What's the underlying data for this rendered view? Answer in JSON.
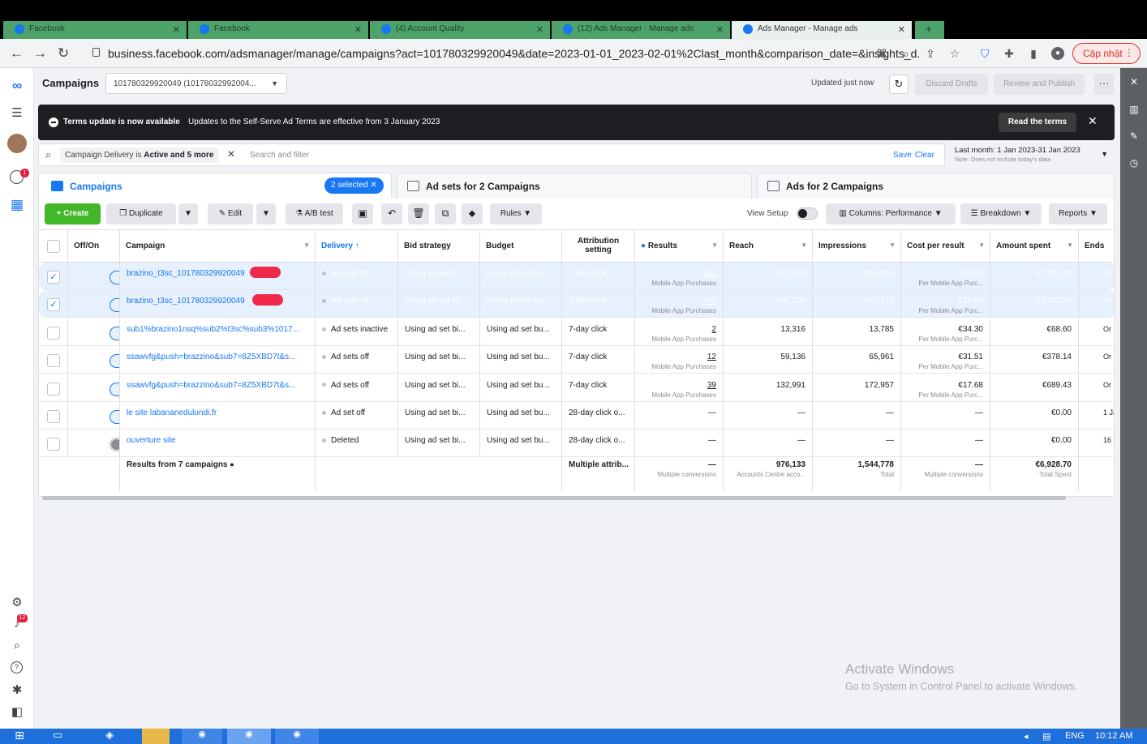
{
  "browser": {
    "tabs": [
      {
        "label": "Facebook"
      },
      {
        "label": "Facebook"
      },
      {
        "label": "(4) Account Quality"
      },
      {
        "label": "(12) Ads Manager - Manage ads"
      },
      {
        "label": "Ads Manager - Manage ads"
      }
    ],
    "url": "business.facebook.com/adsmanager/manage/campaigns?act=101780329920049&date=2023-01-01_2023-02-01%2Clast_month&comparison_date=&insights_d...",
    "update_label": "Cập nhật"
  },
  "topbar": {
    "title": "Campaigns",
    "account": "101780329920049 (10178032992004...",
    "updated": "Updated just now",
    "discard": "Discard Drafts",
    "review": "Review and Publish",
    "more": "···"
  },
  "banner": {
    "title": "Terms update is now available",
    "text": "Updates to the Self-Serve Ad Terms are effective from 3 January 2023",
    "button": "Read the terms"
  },
  "filter": {
    "chip_prefix": "Campaign Delivery is",
    "chip_bold": "Active and 5 more",
    "placeholder": "Search and filter",
    "save": "Save",
    "clear": "Clear",
    "date_range": "Last month: 1 Jan 2023-31 Jan 2023",
    "date_note": "Note: Does not include today's data"
  },
  "levels": {
    "campaigns": "Campaigns",
    "selected": "2 selected",
    "adsets": "Ad sets for 2 Campaigns",
    "ads": "Ads for 2 Campaigns"
  },
  "toolbar": {
    "create": "+ Create",
    "duplicate": "Duplicate",
    "edit": "Edit",
    "abtest": "A/B test",
    "rules": "Rules",
    "view_setup": "View Setup",
    "columns": "Columns: Performance",
    "breakdown": "Breakdown",
    "reports": "Reports"
  },
  "table": {
    "headers": {
      "offon": "Off/On",
      "campaign": "Campaign",
      "delivery": "Delivery ↑",
      "bid": "Bid strategy",
      "budget": "Budget",
      "attr1": "Attribution",
      "attr2": "setting",
      "results": "Results",
      "reach": "Reach",
      "impressions": "Impressions",
      "cpr": "Cost per result",
      "spent": "Amount spent",
      "ends": "Ends"
    },
    "rows": [
      {
        "checked": "✓",
        "campaign": "brazino_t3sc_101780329920049",
        "delivery": "Ad sets off",
        "bid": "Using ad set bi...",
        "budget": "Using ad set bu...",
        "attr": "7-day click",
        "results": "163",
        "results_sub": "Mobile App Purchases",
        "reach": "472,195",
        "impressions": "619,361",
        "cpr": "€17.06",
        "cpr_sub": "Per Mobile App Purc...",
        "spent": "€2,781.25",
        "ends": "Or"
      },
      {
        "checked": "✓",
        "campaign": "brazino_t3sc_101780329920049",
        "delivery": "Ad sets off",
        "bid": "Using ad set bi...",
        "budget": "Using ad set bu...",
        "attr": "7-day click",
        "results": "159",
        "results_sub": "Mobile App Purchases",
        "reach": "495,236",
        "impressions": "672,714",
        "cpr": "€18.94",
        "cpr_sub": "Per Mobile App Purc...",
        "spent": "€3,011.28",
        "ends": "Or"
      },
      {
        "checked": "",
        "campaign": "sub1%brazino1nsq%sub2%t3sc%sub3%1017...",
        "delivery": "Ad sets inactive",
        "bid": "Using ad set bi...",
        "budget": "Using ad set bu...",
        "attr": "7-day click",
        "results": "2",
        "results_sub": "Mobile App Purchases",
        "reach": "13,316",
        "impressions": "13,785",
        "cpr": "€34.30",
        "cpr_sub": "Per Mobile App Purc...",
        "spent": "€68.60",
        "ends": "Or"
      },
      {
        "checked": "",
        "campaign": "ssawvfg&push=brazzino&sub7=8Z5XBD7t&s...",
        "delivery": "Ad sets off",
        "bid": "Using ad set bi...",
        "budget": "Using ad set bu...",
        "attr": "7-day click",
        "results": "12",
        "results_sub": "Mobile App Purchases",
        "reach": "59,136",
        "impressions": "65,961",
        "cpr": "€31.51",
        "cpr_sub": "Per Mobile App Purc...",
        "spent": "€378.14",
        "ends": "Or"
      },
      {
        "checked": "",
        "campaign": "ssawvfg&push=brazzino&sub7=8Z5XBD7t&s...",
        "delivery": "Ad sets off",
        "bid": "Using ad set bi...",
        "budget": "Using ad set bu...",
        "attr": "7-day click",
        "results": "39",
        "results_sub": "Mobile App Purchases",
        "reach": "132,991",
        "impressions": "172,957",
        "cpr": "€17.68",
        "cpr_sub": "Per Mobile App Purc...",
        "spent": "€689.43",
        "ends": "Or"
      },
      {
        "checked": "",
        "campaign": "le site labananedulundi.fr",
        "delivery": "Ad set off",
        "bid": "Using ad set bi...",
        "budget": "Using ad set bu...",
        "attr": "28-day click o...",
        "results": "—",
        "results_sub": "",
        "reach": "—",
        "impressions": "—",
        "cpr": "—",
        "cpr_sub": "",
        "spent": "€0.00",
        "ends": "1 Ja"
      },
      {
        "checked": "",
        "campaign": "ouverture site",
        "delivery": "Deleted",
        "bid": "Using ad set bi...",
        "budget": "Using ad set bu...",
        "attr": "28-day click o...",
        "results": "—",
        "results_sub": "",
        "reach": "—",
        "impressions": "—",
        "cpr": "—",
        "cpr_sub": "",
        "spent": "€0.00",
        "ends": "16 O"
      }
    ],
    "totals": {
      "label": "Results from 7 campaigns",
      "attr": "Multiple attrib...",
      "results": "—",
      "results_sub": "Multiple conversions",
      "reach": "976,133",
      "reach_sub": "Accounts Centre acco...",
      "impressions": "1,544,778",
      "impressions_sub": "Total",
      "cpr": "—",
      "cpr_sub": "Multiple conversions",
      "spent": "€6,928.70",
      "spent_sub": "Total Spent"
    }
  },
  "watermark": {
    "title": "Activate Windows",
    "text": "Go to System in Control Panel to activate Windows."
  },
  "taskbar": {
    "lang": "ENG",
    "time": "10:12 AM"
  },
  "badges": {
    "notifications": "1",
    "alerts": "12"
  },
  "colors": {
    "accent": "#1877f2",
    "create": "#42b72a",
    "taskbar": "#1e6fd9"
  }
}
